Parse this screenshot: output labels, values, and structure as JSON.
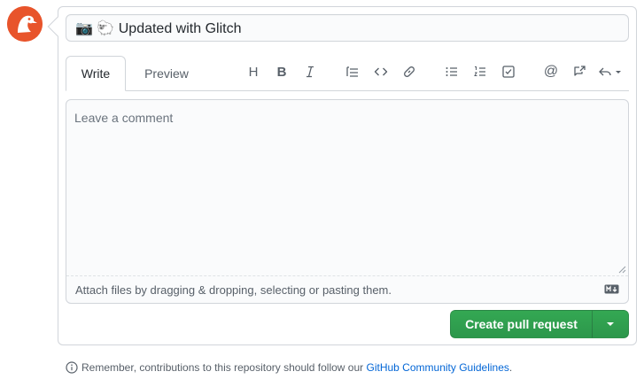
{
  "avatar": {
    "icon": "dodo-bird-avatar",
    "color": "#e8542b"
  },
  "title_field": {
    "value": "📷 🐑 Updated with Glitch"
  },
  "tabs": [
    {
      "label": "Write",
      "active": true
    },
    {
      "label": "Preview",
      "active": false
    }
  ],
  "toolbar": {
    "groups": [
      [
        "heading-icon",
        "bold-icon",
        "italic-icon"
      ],
      [
        "quote-icon",
        "code-icon",
        "link-icon"
      ],
      [
        "unordered-list-icon",
        "ordered-list-icon",
        "task-list-icon"
      ],
      [
        "mention-icon",
        "cross-reference-icon",
        "reply-icon"
      ]
    ],
    "heading_glyph": "H",
    "bold_glyph": "B",
    "mention_glyph": "@"
  },
  "comment": {
    "placeholder": "Leave a comment",
    "value": "",
    "attach_hint": "Attach files by dragging & dropping, selecting or pasting them."
  },
  "actions": {
    "create_label": "Create pull request",
    "accent_color": "#2ea44f"
  },
  "footer": {
    "note_prefix": "Remember, contributions to this repository should follow our ",
    "link_text": "GitHub Community Guidelines",
    "note_suffix": "."
  }
}
